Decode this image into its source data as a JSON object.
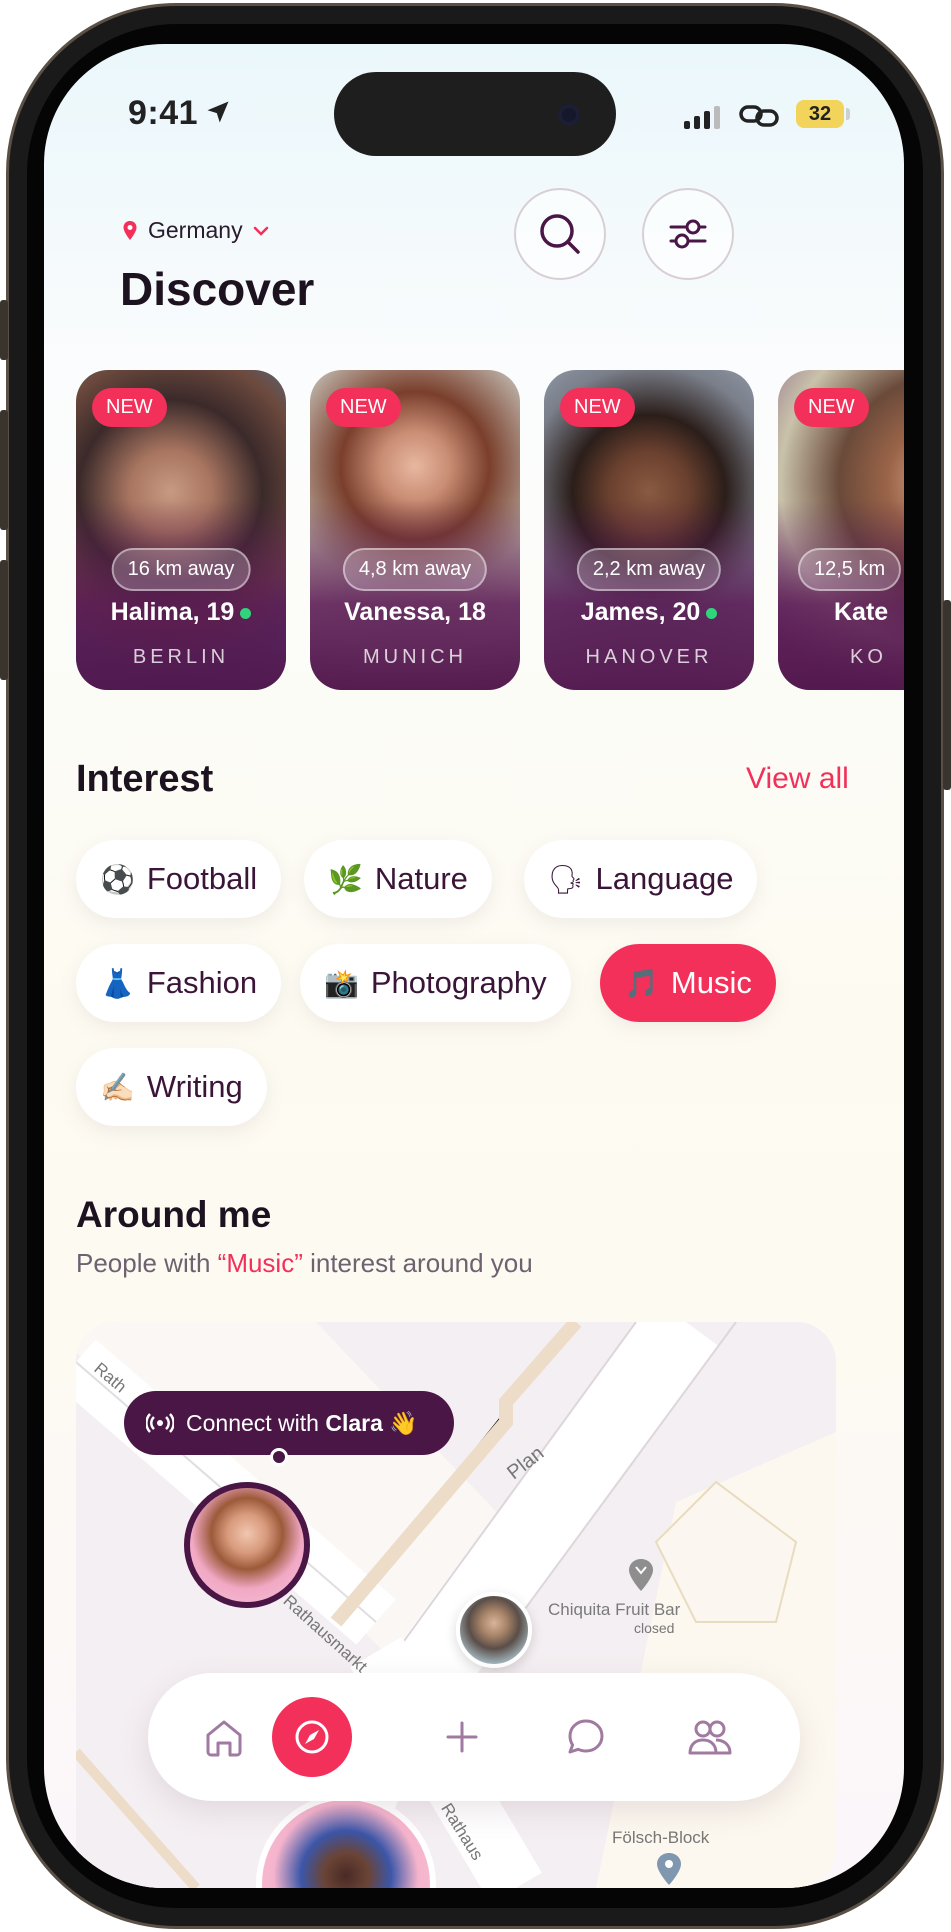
{
  "status_bar": {
    "time": "9:41",
    "battery": "32"
  },
  "header": {
    "country": "Germany",
    "title": "Discover"
  },
  "profiles": [
    {
      "badge": "NEW",
      "distance": "16 km away",
      "name": "Halima, 19",
      "city": "BERLIN",
      "online": true
    },
    {
      "badge": "NEW",
      "distance": "4,8 km away",
      "name": "Vanessa, 18",
      "city": "MUNICH",
      "online": false
    },
    {
      "badge": "NEW",
      "distance": "2,2 km away",
      "name": "James, 20",
      "city": "HANOVER",
      "online": true
    },
    {
      "badge": "NEW",
      "distance": "12,5 km",
      "name": "Kate",
      "city": "KO",
      "online": false
    }
  ],
  "interest": {
    "title": "Interest",
    "view_all": "View all",
    "chips": [
      {
        "emoji": "⚽",
        "label": "Football"
      },
      {
        "emoji": "🌿",
        "label": "Nature"
      },
      {
        "emoji": "🗣",
        "label": "Language"
      },
      {
        "emoji": "👗",
        "label": "Fashion"
      },
      {
        "emoji": "📸",
        "label": "Photography"
      },
      {
        "emoji": "🎵",
        "label": "Music",
        "active": true
      },
      {
        "emoji": "✍🏻",
        "label": "Writing"
      }
    ]
  },
  "around_me": {
    "title": "Around me",
    "subtitle_pre": "People with ",
    "subtitle_hl": "“Music”",
    "subtitle_post": " interest around you",
    "connect_pre": "Connect with ",
    "connect_name": "Clara",
    "connect_emoji": "👋"
  },
  "map_labels": {
    "street1": "Rathausmarkt",
    "street2": "Plan",
    "street3": "Rath",
    "street4": "Rathaus",
    "poi1": "Chiquita Fruit Bar",
    "poi1_status": "closed",
    "poi2": "Fölsch-Block"
  },
  "colors": {
    "accent": "#f2305a",
    "dark_purple": "#4a1646",
    "online": "#2fd57a"
  }
}
